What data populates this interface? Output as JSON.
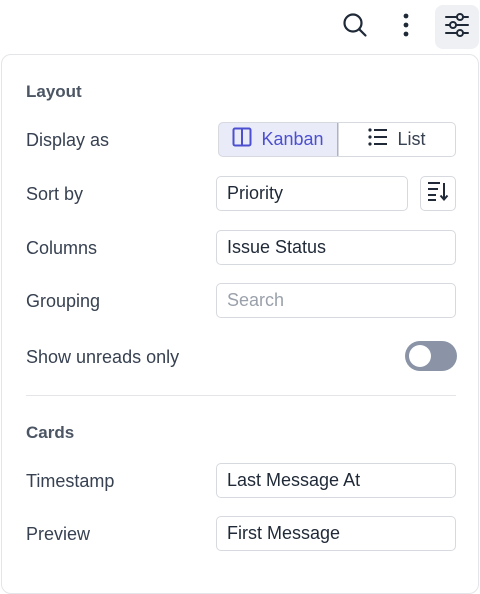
{
  "toolbar": {
    "search_icon": "search-icon",
    "more_icon": "more-vertical-icon",
    "settings_icon": "sliders-icon"
  },
  "layout": {
    "title": "Layout",
    "display_as": {
      "label": "Display as",
      "options": [
        {
          "label": "Kanban",
          "icon": "columns-icon",
          "selected": true
        },
        {
          "label": "List",
          "icon": "list-icon",
          "selected": false
        }
      ]
    },
    "sort_by": {
      "label": "Sort by",
      "value": "Priority",
      "direction_icon": "sort-descending-icon"
    },
    "columns": {
      "label": "Columns",
      "value": "Issue Status"
    },
    "grouping": {
      "label": "Grouping",
      "placeholder": "Search"
    },
    "show_unreads": {
      "label": "Show unreads only",
      "enabled": false
    }
  },
  "cards": {
    "title": "Cards",
    "timestamp": {
      "label": "Timestamp",
      "value": "Last Message At"
    },
    "preview": {
      "label": "Preview",
      "value": "First Message"
    }
  },
  "colors": {
    "accent": "#4c4fd0",
    "accent_bg": "#e9ebf9",
    "toggle_off": "#8a94a6",
    "border": "#d6d9de"
  }
}
